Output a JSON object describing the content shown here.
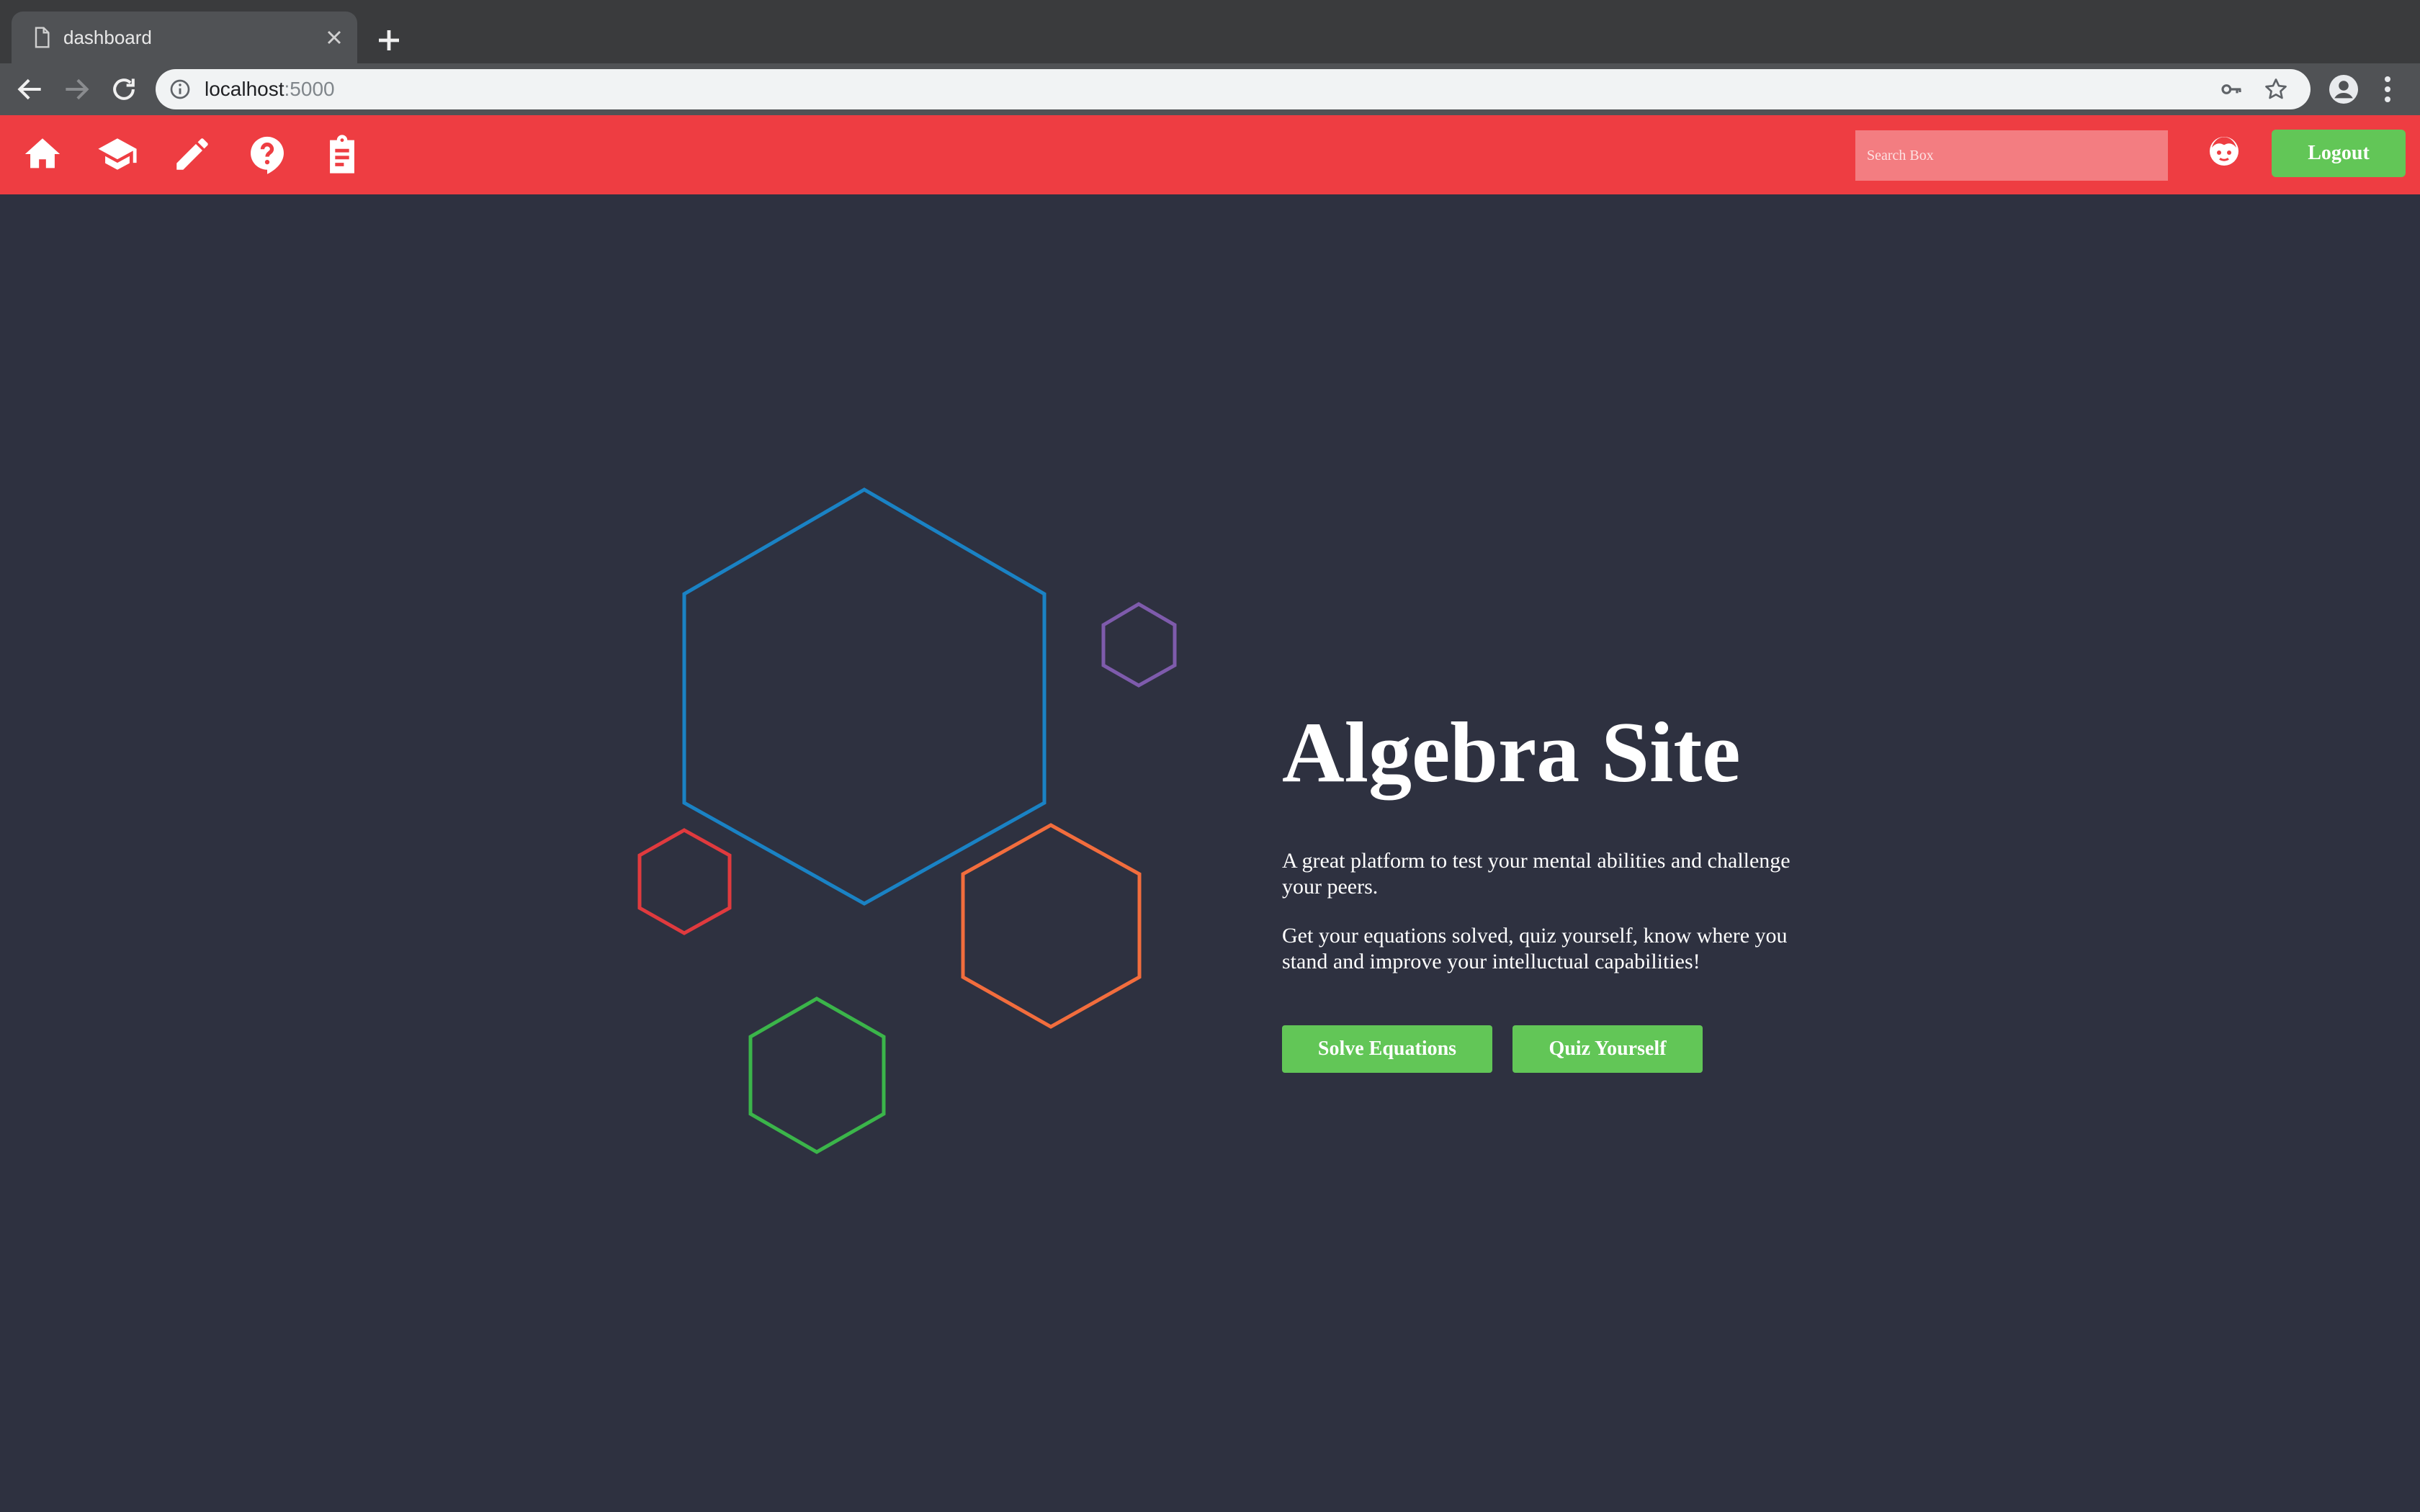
{
  "browser": {
    "tab_title": "dashboard",
    "url_host": "localhost",
    "url_port": ":5000",
    "icons": [
      "page-icon",
      "close-icon",
      "plus-icon",
      "back-arrow-icon",
      "forward-arrow-icon",
      "reload-icon",
      "info-icon",
      "key-icon",
      "star-icon",
      "profile-icon",
      "menu-icon"
    ]
  },
  "nav": {
    "icons": [
      "home-icon",
      "graduation-cap-icon",
      "pencil-icon",
      "question-bubble-icon",
      "clipboard-icon",
      "smiley-icon"
    ],
    "search_placeholder": "Search Box",
    "logout_label": "Logout",
    "bar_color": "#ee3d42"
  },
  "hero": {
    "title": "Algebra Site",
    "paragraph1": "A great platform to test your mental abilities and challenge your peers.",
    "paragraph2": "Get your equations solved, quiz yourself, know where you stand and improve your intelluctual capabilities!",
    "buttons": [
      "Solve Equations",
      "Quiz Yourself"
    ],
    "button_color": "#62c657"
  },
  "decor": {
    "hexagon_colors": [
      "#1a82c4",
      "#7e5bac",
      "#e03a3e",
      "#f26d3d",
      "#3bb54a"
    ]
  },
  "background_color": "#2e3140"
}
